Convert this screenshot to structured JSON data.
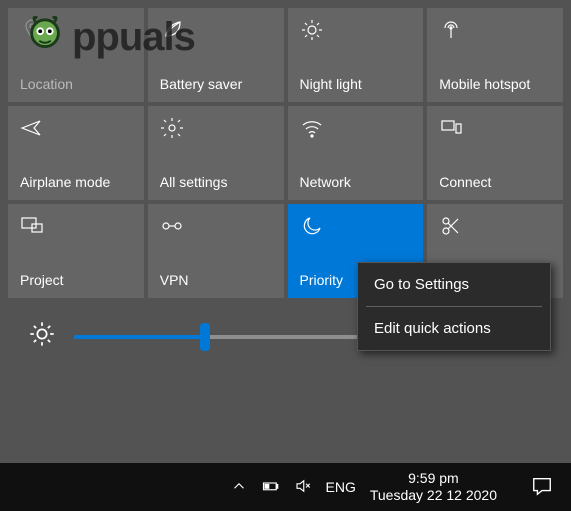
{
  "watermark": {
    "text": "ppuals"
  },
  "tiles": [
    {
      "id": "location",
      "label": "Location",
      "icon": "map-pin-icon",
      "state": "dim"
    },
    {
      "id": "battery-saver",
      "label": "Battery saver",
      "icon": "leaf-icon",
      "state": "normal"
    },
    {
      "id": "night-light",
      "label": "Night light",
      "icon": "sun-icon",
      "state": "normal"
    },
    {
      "id": "mobile-hotspot",
      "label": "Mobile hotspot",
      "icon": "antenna-icon",
      "state": "normal"
    },
    {
      "id": "airplane-mode",
      "label": "Airplane mode",
      "icon": "airplane-icon",
      "state": "normal"
    },
    {
      "id": "all-settings",
      "label": "All settings",
      "icon": "gear-icon",
      "state": "normal"
    },
    {
      "id": "network",
      "label": "Network",
      "icon": "wifi-icon",
      "state": "normal"
    },
    {
      "id": "connect",
      "label": "Connect",
      "icon": "connect-icon",
      "state": "normal"
    },
    {
      "id": "project",
      "label": "Project",
      "icon": "project-icon",
      "state": "normal"
    },
    {
      "id": "vpn",
      "label": "VPN",
      "icon": "vpn-icon",
      "state": "normal"
    },
    {
      "id": "priority",
      "label": "Priority",
      "icon": "moon-icon",
      "state": "active"
    },
    {
      "id": "screen-snip",
      "label": "",
      "icon": "snip-icon",
      "state": "normal"
    }
  ],
  "brightness": {
    "value": 28
  },
  "context_menu": {
    "go_to_settings": "Go to Settings",
    "edit_quick_actions": "Edit quick actions"
  },
  "taskbar": {
    "language": "ENG",
    "time": "9:59 pm",
    "date": "Tuesday 22 12 2020"
  },
  "colors": {
    "accent": "#0078d7"
  }
}
